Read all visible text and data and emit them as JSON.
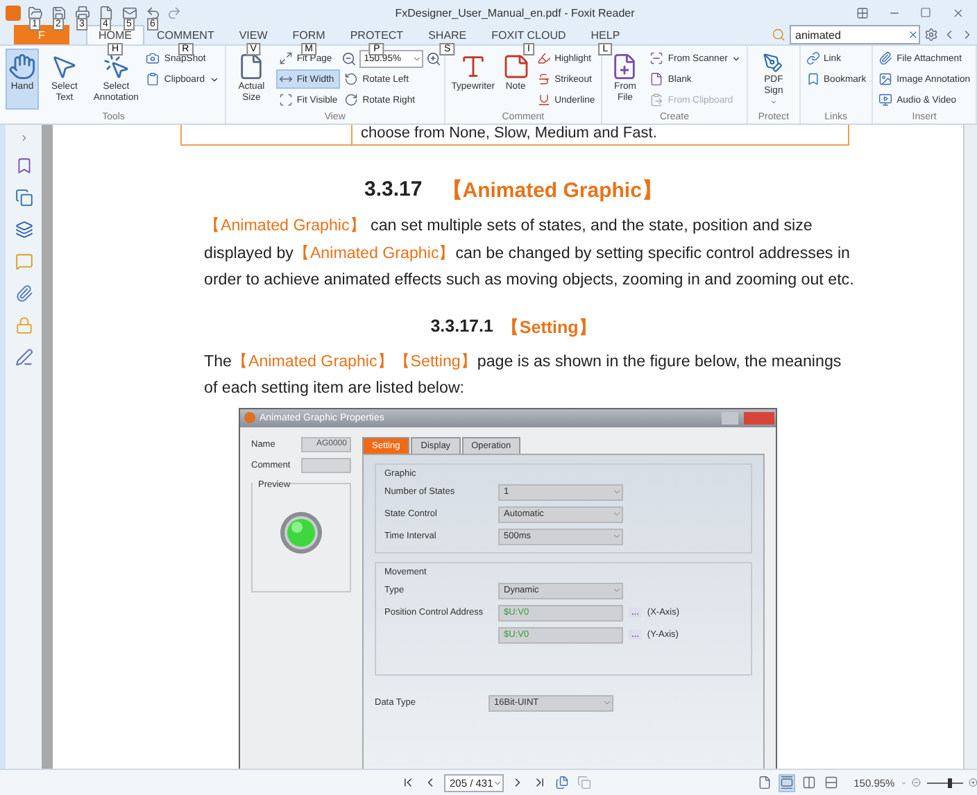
{
  "title_bar": {
    "keytips": [
      "1",
      "2",
      "3",
      "4",
      "5",
      "6"
    ],
    "title": "FxDesigner_User_Manual_en.pdf - Foxit Reader"
  },
  "file_tab": {
    "label": "F"
  },
  "tabs": [
    {
      "label": "HOME",
      "keytip": "H",
      "selected": true
    },
    {
      "label": "COMMENT",
      "keytip": "R",
      "selected": false
    },
    {
      "label": "VIEW",
      "keytip": "V",
      "selected": false
    },
    {
      "label": "FORM",
      "keytip": "M",
      "selected": false
    },
    {
      "label": "PROTECT",
      "keytip": "P",
      "selected": false
    },
    {
      "label": "SHARE",
      "keytip": "S",
      "selected": false
    },
    {
      "label": "FOXIT CLOUD",
      "keytip": "I",
      "selected": false
    },
    {
      "label": "HELP",
      "keytip": "L",
      "selected": false
    }
  ],
  "search": {
    "value": "animated"
  },
  "ribbon_groups": [
    {
      "label": "Tools",
      "columns": [
        [
          {
            "kind": "large",
            "label": "Hand",
            "selected": true
          }
        ],
        [
          {
            "kind": "large",
            "label": "Select Text",
            "selected": false
          }
        ],
        [
          {
            "kind": "large",
            "label": "Select Annotation",
            "selected": false
          }
        ],
        [
          {
            "kind": "small",
            "label": "SnapShot",
            "selected": false
          },
          {
            "kind": "small",
            "label": "Clipboard",
            "selected": false,
            "menu": true
          }
        ]
      ]
    },
    {
      "label": "View",
      "columns": [
        [
          {
            "kind": "large",
            "label": "Actual Size",
            "selected": false
          }
        ],
        [
          {
            "kind": "small",
            "label": "Fit Page",
            "selected": false
          },
          {
            "kind": "small",
            "label": "Fit Width",
            "selected": true
          },
          {
            "kind": "small",
            "label": "Fit Visible",
            "selected": false
          }
        ],
        [
          {
            "kind": "zoom",
            "value": "150.95%"
          },
          {
            "kind": "small",
            "label": "Rotate Left",
            "selected": false
          },
          {
            "kind": "small",
            "label": "Rotate Right",
            "selected": false
          }
        ]
      ]
    },
    {
      "label": "Comment",
      "columns": [
        [
          {
            "kind": "large",
            "label": "Typewriter",
            "selected": false
          }
        ],
        [
          {
            "kind": "large",
            "label": "Note",
            "selected": false
          }
        ],
        [
          {
            "kind": "small",
            "label": "Highlight",
            "selected": false
          },
          {
            "kind": "small",
            "label": "Strikeout",
            "selected": false
          },
          {
            "kind": "small",
            "label": "Underline",
            "selected": false
          }
        ]
      ]
    },
    {
      "label": "Create",
      "columns": [
        [
          {
            "kind": "large",
            "label": "From File",
            "selected": false
          }
        ],
        [
          {
            "kind": "small",
            "label": "From Scanner",
            "selected": false,
            "menu": true
          },
          {
            "kind": "small",
            "label": "Blank",
            "selected": false
          },
          {
            "kind": "small",
            "label": "From Clipboard",
            "selected": false,
            "disabled": true
          }
        ]
      ]
    },
    {
      "label": "Protect",
      "columns": [
        [
          {
            "kind": "large",
            "label": "PDF Sign",
            "selected": false,
            "menu": true
          }
        ]
      ]
    },
    {
      "label": "Links",
      "columns": [
        [
          {
            "kind": "small",
            "label": "Link",
            "selected": false
          },
          {
            "kind": "small",
            "label": "Bookmark",
            "selected": false
          }
        ]
      ]
    },
    {
      "label": "Insert",
      "columns": [
        [
          {
            "kind": "small",
            "label": "File Attachment",
            "selected": false
          },
          {
            "kind": "small",
            "label": "Image Annotation",
            "selected": false
          },
          {
            "kind": "small",
            "label": "Audio & Video",
            "selected": false
          }
        ]
      ]
    }
  ],
  "document": {
    "table_cell": "choose from None, Slow, Medium and Fast.",
    "heading": {
      "number": "3.3.17",
      "title": "【Animated Graphic】"
    },
    "paragraph_1": [
      {
        "text": "【Animated Graphic】",
        "accent": true
      },
      {
        "text": " can set multiple sets of states, and the state, position and size displayed by",
        "accent": false
      },
      {
        "text": "【Animated Graphic】",
        "accent": true
      },
      {
        "text": "can be changed by setting specific control addresses in order to achieve animated effects such as moving objects, zooming in and zooming out etc.",
        "accent": false
      }
    ],
    "subheading": {
      "number": "3.3.17.1",
      "title": "【Setting】"
    },
    "paragraph_2": [
      {
        "text": "The",
        "accent": false
      },
      {
        "text": "【Animated Graphic】【Setting】",
        "accent": true
      },
      {
        "text": "page is as shown in the figure below, the meanings of each setting item are listed below:",
        "accent": false
      }
    ],
    "dialog": {
      "title": "Animated Graphic Properties",
      "name_label": "Name",
      "name_value": "AG0000",
      "comment_label": "Comment",
      "preview_label": "Preview",
      "tabs": [
        {
          "label": "Setting",
          "selected": true
        },
        {
          "label": "Display",
          "selected": false
        },
        {
          "label": "Operation",
          "selected": false
        }
      ],
      "graphic": {
        "legend": "Graphic",
        "rows": [
          {
            "label": "Number of States",
            "value": "1"
          },
          {
            "label": "State Control",
            "value": "Automatic"
          },
          {
            "label": "Time Interval",
            "value": "500ms"
          }
        ]
      },
      "movement": {
        "legend": "Movement",
        "rows": [
          {
            "kind": "select",
            "label": "Type",
            "value": "Dynamic"
          },
          {
            "kind": "address",
            "label": "Position Control Address",
            "value": "$U:V0",
            "browse": "...",
            "suffix": "(X-Axis)"
          },
          {
            "kind": "address",
            "value": "$U:V0",
            "browse": "...",
            "suffix": "(Y-Axis)"
          }
        ]
      },
      "data_type": {
        "label": "Data Type",
        "value": "16Bit-UINT"
      }
    }
  },
  "status_bar": {
    "page": "205 / 431",
    "view_modes": [
      {
        "selected": false
      },
      {
        "selected": true
      },
      {
        "selected": false
      },
      {
        "selected": false
      }
    ],
    "zoom": "150.95%",
    "zoom_slider": {
      "level": 0.6
    }
  }
}
